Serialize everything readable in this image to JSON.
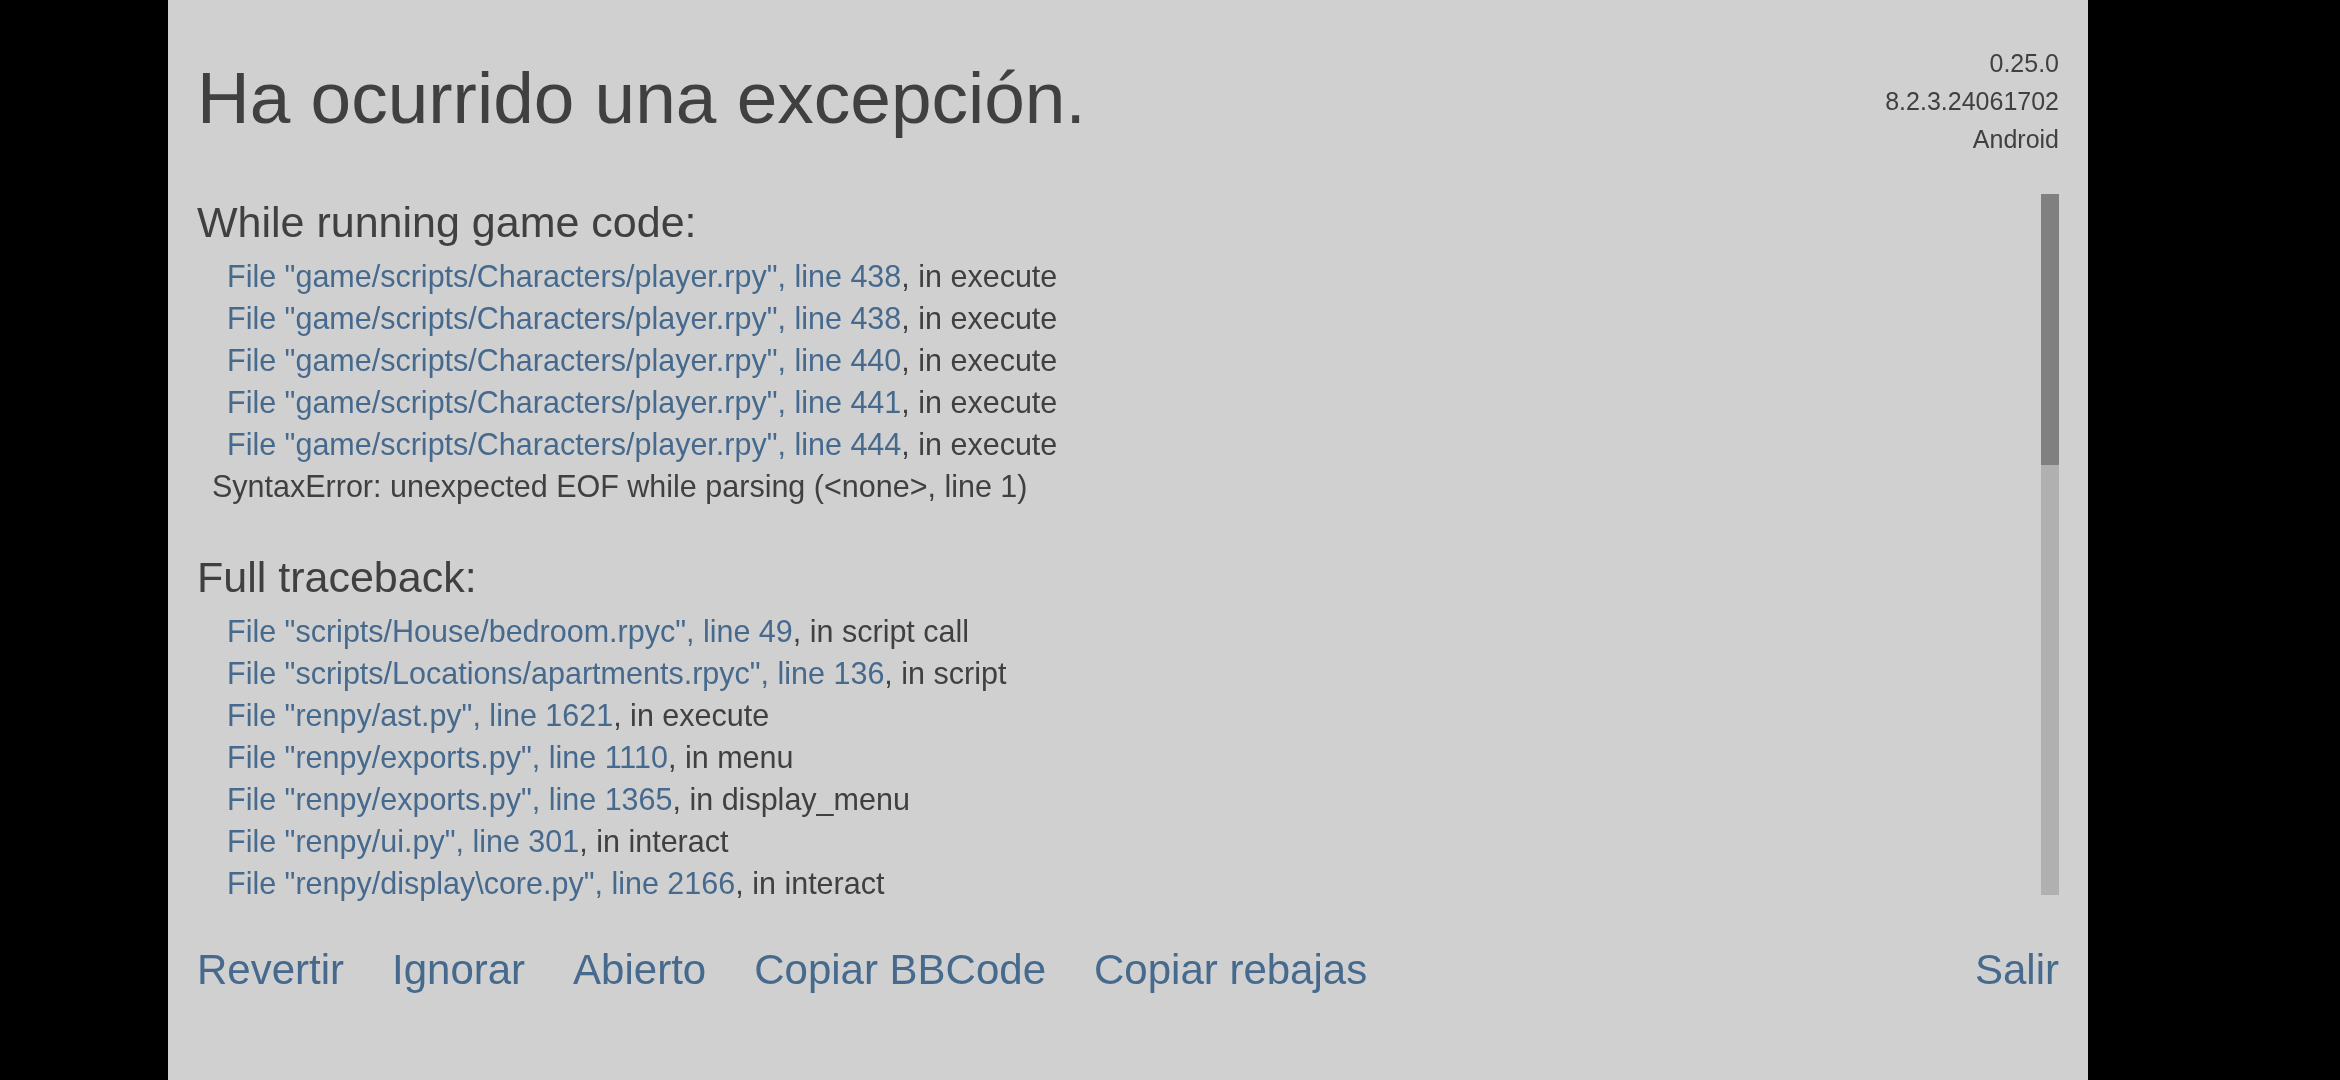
{
  "header": {
    "title": "Ha ocurrido una excepción.",
    "version_lines": [
      "0.25.0",
      "8.2.3.24061702",
      "Android"
    ]
  },
  "sections": [
    {
      "heading": "While running game code:",
      "frames": [
        {
          "file_link": "File \"game/scripts/Characters/player.rpy\", line 438",
          "context": ", in execute"
        },
        {
          "file_link": "File \"game/scripts/Characters/player.rpy\", line 438",
          "context": ", in execute"
        },
        {
          "file_link": "File \"game/scripts/Characters/player.rpy\", line 440",
          "context": ", in execute"
        },
        {
          "file_link": "File \"game/scripts/Characters/player.rpy\", line 441",
          "context": ", in execute"
        },
        {
          "file_link": "File \"game/scripts/Characters/player.rpy\", line 444",
          "context": ", in execute"
        }
      ],
      "error": "SyntaxError: unexpected EOF while parsing (<none>, line 1)"
    },
    {
      "heading": "Full traceback:",
      "frames": [
        {
          "file_link": "File \"scripts/House/bedroom.rpyc\", line 49",
          "context": ", in script call"
        },
        {
          "file_link": "File \"scripts/Locations/apartments.rpyc\", line 136",
          "context": ", in script"
        },
        {
          "file_link": "File \"renpy/ast.py\", line 1621",
          "context": ", in execute"
        },
        {
          "file_link": "File \"renpy/exports.py\", line 1110",
          "context": ", in menu"
        },
        {
          "file_link": "File \"renpy/exports.py\", line 1365",
          "context": ", in display_menu"
        },
        {
          "file_link": "File \"renpy/ui.py\", line 301",
          "context": ", in interact"
        },
        {
          "file_link": "File \"renpy/display\\core.py\", line 2166",
          "context": ", in interact"
        }
      ]
    }
  ],
  "actions": [
    "Revertir",
    "Ignorar",
    "Abierto",
    "Copiar BBCode",
    "Copiar rebajas"
  ],
  "exit_action": "Salir"
}
